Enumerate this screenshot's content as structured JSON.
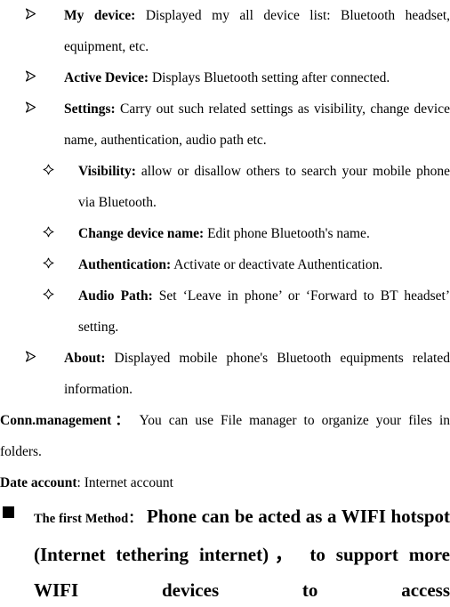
{
  "document": {
    "bullets_level1": [
      {
        "marker": "arrow-bullet",
        "term": "My device:",
        "text": " Displayed my all device list: Bluetooth headset, equipment, etc."
      },
      {
        "marker": "arrow-bullet",
        "term": "Active Device:",
        "text": " Displays Bluetooth setting after connected."
      },
      {
        "marker": "arrow-bullet",
        "term": "Settings:",
        "text": " Carry out such related settings as visibility, change device name, authentication, audio path etc."
      }
    ],
    "bullets_level2": [
      {
        "marker": "star-bullet",
        "term": "Visibility:",
        "text": " allow or disallow others to search your mobile phone via Bluetooth."
      },
      {
        "marker": "star-bullet",
        "term": "Change device name:",
        "text": " Edit phone Bluetooth's name."
      },
      {
        "marker": "star-bullet",
        "term": "Authentication:",
        "text": " Activate or deactivate Authentication."
      },
      {
        "marker": "star-bullet",
        "term": "Audio Path:",
        "text": " Set ‘Leave in phone’ or ‘Forward to BT headset’ setting."
      }
    ],
    "bullet_about": {
      "marker": "arrow-bullet",
      "term": "About:",
      "text": " Displayed mobile phone's Bluetooth equipments related information."
    },
    "paragraphs": [
      {
        "term": "Conn.management：",
        "text": "  You can use File manager to organize your files in folders."
      },
      {
        "term": "Date account",
        "text": ": Internet account"
      }
    ],
    "final_block": {
      "marker": "square-bullet",
      "label": "The first Method：",
      "text": "  Phone can be acted as a WIFI hotspot (Internet tethering  internet)， to support more WIFI devices to access"
    }
  }
}
